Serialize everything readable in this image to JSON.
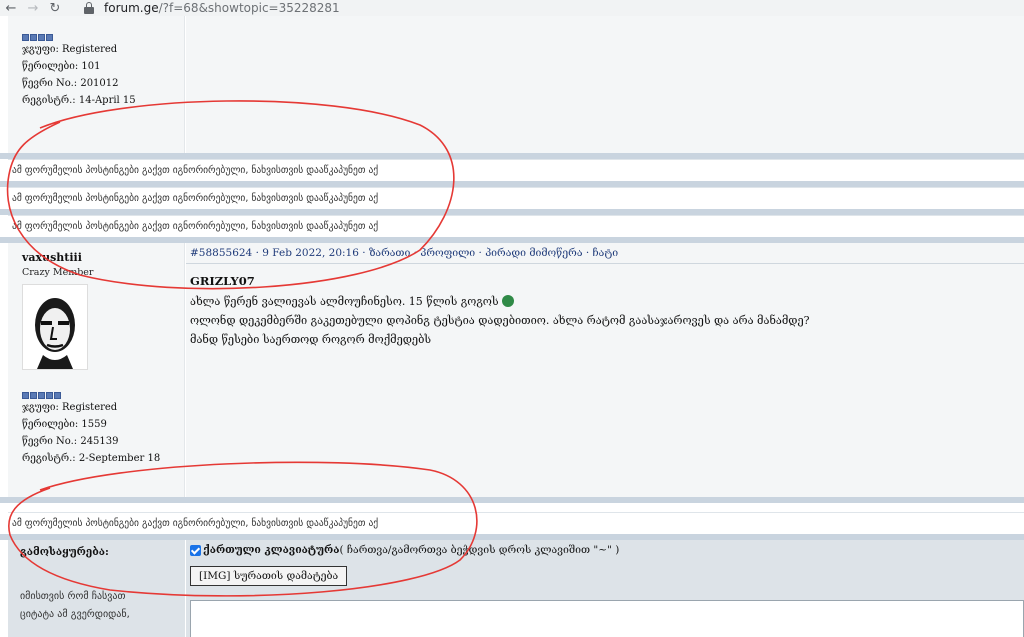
{
  "browser": {
    "url_domain": "forum.ge",
    "url_path": "/?f=68&showtopic=35228281"
  },
  "top_user": {
    "group": "ჯგუფი: Registered",
    "posts": "წერილები: 101",
    "member_no": "წევრი No.: 201012",
    "registered": "რეგისტრ.: 14-April 15"
  },
  "ignored_text": "ამ ფორუმელის პოსტინგები გაქვთ იგნორირებული, ნახვისთვის დააწკაპუნეთ აქ",
  "post": {
    "author": "vaxushtiii",
    "title": "Crazy Member",
    "group": "ჯგუფი: Registered",
    "posts": "წერილები: 1559",
    "member_no": "წევრი No.: 245139",
    "registered": "რეგისტრ.: 2-September 18",
    "head": {
      "id_date": "#58855624 · 9 Feb 2022, 20:16 · ",
      "link_reply": "ზარათი",
      "dot1": " · ",
      "link_profile": "პროფილი",
      "dot2": " · ",
      "link_pm": "პირადი მიმოწერა",
      "dot3": " · ",
      "link_chat": "ჩატი"
    },
    "quote_author": "GRIZLY07",
    "lines": [
      "ახლა წერენ ვალიევას ალმოუჩინესო. 15 წლის გოგოს",
      "ოლონდ დეკემბერში გაკეთებული დოპინგ ტესტია დადებითიო. ახლა რატომ გაასაჯაროვეს და არა მანამდე?",
      "მანდ წესები საერთოდ როგორ მოქმედებს"
    ]
  },
  "reply": {
    "options_label": "გამოსაყურება:",
    "keyboard_label": "ქართული კლავიატურა",
    "keyboard_hint": " ( ჩართვა/გამორთვა ბეჭდვის დროს კლავიშით \"~\" )",
    "img_button": "[IMG] სურათის დამატება",
    "help_line1": "იმისთვის რომ ჩასვათ",
    "help_line2": "ციტატა ამ გვერდიდან,"
  }
}
